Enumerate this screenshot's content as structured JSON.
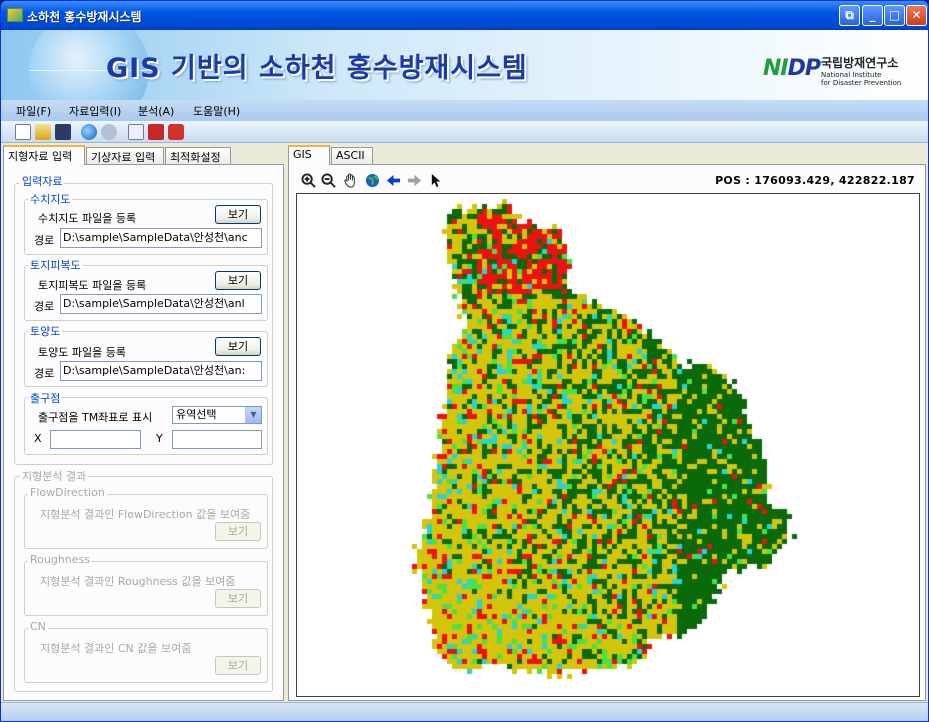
{
  "window": {
    "title": "소하천 홍수방재시스템"
  },
  "banner": {
    "title": "GIS 기반의 소하천 홍수방재시스템",
    "logo": "NIDP",
    "org_kr": "국립방재연구소",
    "org_en_1": "National Institute",
    "org_en_2": "for Disaster Prevention"
  },
  "menu": [
    "파일(F)",
    "자료입력(I)",
    "분석(A)",
    "도움말(H)"
  ],
  "toolbar_icons": [
    "new-icon",
    "open-icon",
    "save-icon",
    "globe-icon",
    "chat-icon",
    "document-icon",
    "pdf-icon",
    "acrobat-icon"
  ],
  "left_tabs": [
    "지형자료 입력",
    "기상자료 입력",
    "최적화설정"
  ],
  "input": {
    "title": "입력자료",
    "dem": {
      "title": "수치지도",
      "desc": "수치지도 파일을 등록",
      "button": "보기",
      "path_label": "경로",
      "path": "D:\\sample\\SampleData\\안성천\\anc"
    },
    "landcover": {
      "title": "토지피복도",
      "desc": "토지피복도 파일을 등록",
      "button": "보기",
      "path_label": "경로",
      "path": "D:\\sample\\SampleData\\안성천\\anl"
    },
    "soil": {
      "title": "토양도",
      "desc": "토양도 파일을 등록",
      "button": "보기",
      "path_label": "경로",
      "path": "D:\\sample\\SampleData\\안성천\\an:"
    },
    "outlet": {
      "title": "출구점",
      "desc": "출구점을 TM좌표로 표시",
      "select": "유역선택",
      "x_label": "X",
      "y_label": "Y",
      "x": "",
      "y": ""
    }
  },
  "analysis": {
    "title": "지형분석 결과",
    "flow": {
      "title": "FlowDirection",
      "desc": "지형분석 결과인 FlowDirection 값을 보여줌",
      "button": "보기"
    },
    "rough": {
      "title": "Roughness",
      "desc": "지형분석 결과인 Roughness 값을 보여줌",
      "button": "보기"
    },
    "cn": {
      "title": "CN",
      "desc": "지형분석 결과인  CN 값을 보여줌",
      "button": "보기"
    }
  },
  "right_tabs": [
    "GIS",
    "ASCII"
  ],
  "map": {
    "pos_text": "POS : 176093.429,  422822.187",
    "tool_icons": [
      "zoom-in-icon",
      "zoom-out-icon",
      "pan-hand-icon",
      "full-extent-globe-icon",
      "back-arrow-icon",
      "forward-arrow-icon",
      "select-pointer-icon"
    ],
    "colors": {
      "forest": "#0a6a0a",
      "agri": "#d4c40a",
      "urban": "#ee1111",
      "water": "#22d6d6",
      "grass": "#49e149"
    }
  }
}
